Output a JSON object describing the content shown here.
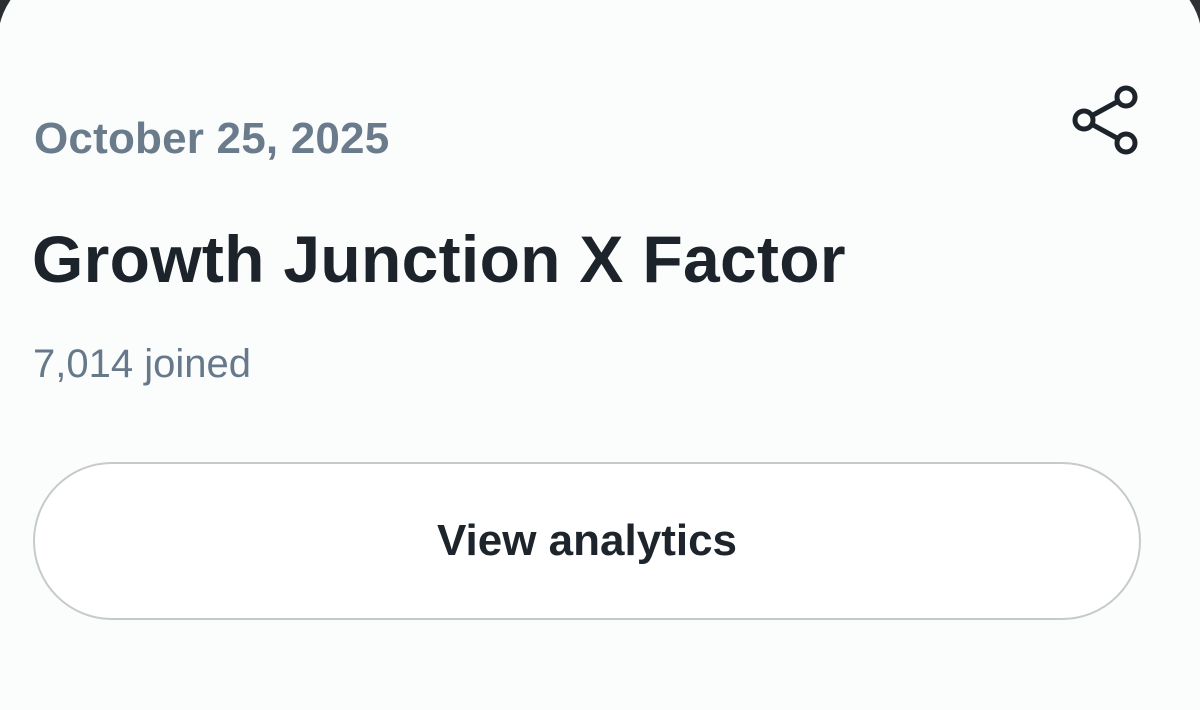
{
  "event": {
    "date": "October 25, 2025",
    "title": "Growth Junction X Factor",
    "joined": "7,014 joined"
  },
  "actions": {
    "share_icon": "share-icon",
    "view_analytics_label": "View analytics"
  },
  "colors": {
    "card_background": "#fbfcfc",
    "date_text": "#6a7c8c",
    "title_text": "#1c232a",
    "muted_text": "#66788a",
    "button_border": "#c7cacd"
  }
}
